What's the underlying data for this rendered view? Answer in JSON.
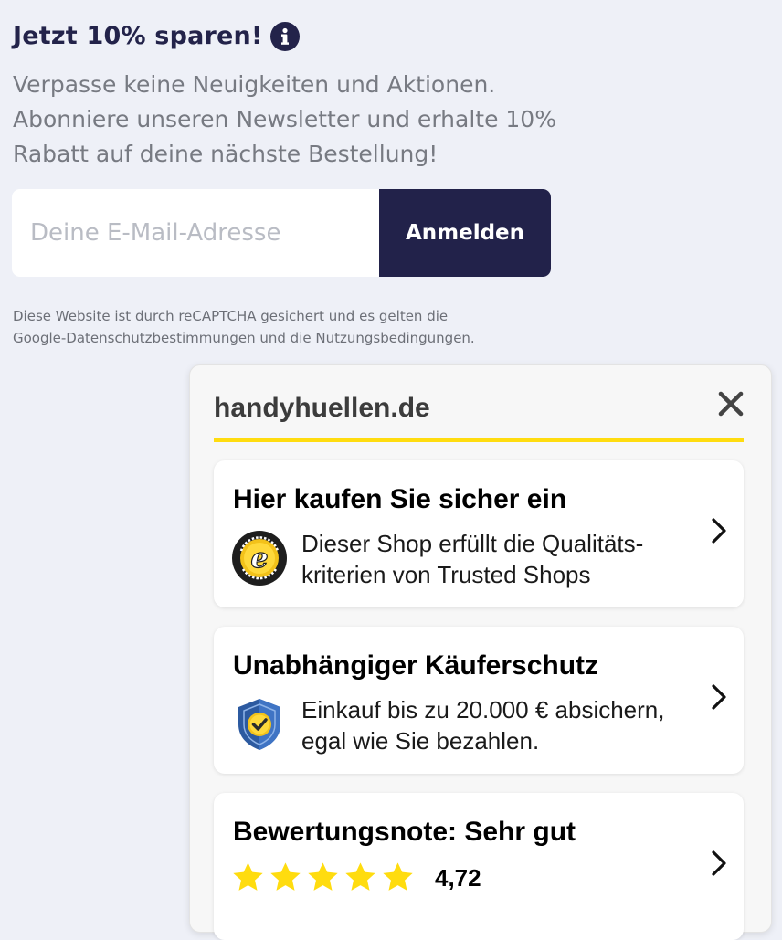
{
  "newsletter": {
    "title": "Jetzt 10% sparen!",
    "text_lines": [
      "Verpasse keine Neuigkeiten und Aktionen.",
      "Abonniere unseren Newsletter und erhalte 10%",
      "Rabatt auf deine nächste Bestellung!"
    ],
    "email_placeholder": "Deine E-Mail-Adresse",
    "email_value": "",
    "submit_label": "Anmelden",
    "recaptcha_lines": [
      "Diese Website ist durch reCAPTCHA gesichert und es gelten die",
      "Google-Datenschutzbestimmungen und die Nutzungsbedingungen."
    ]
  },
  "trusted_shops": {
    "shop_name": "handyhuellen.de",
    "cards": [
      {
        "title": "Hier kaufen Sie sicher ein",
        "desc_lines": [
          "Dieser Shop erfüllt die Qualitäts-",
          "kriterien von Trusted Shops"
        ],
        "icon": "trusted-shops-seal-icon"
      },
      {
        "title": "Unabhängiger Käuferschutz",
        "desc_lines": [
          "Einkauf bis zu 20.000 € absichern,",
          "egal wie Sie bezahlen."
        ],
        "icon": "shield-check-icon"
      },
      {
        "title": "Bewertungsnote: Sehr gut",
        "rating": "4,72",
        "stars": 5,
        "icon": "star-icon"
      }
    ]
  },
  "colors": {
    "background": "#eef0f7",
    "navy": "#22224a",
    "accent_yellow": "#ffdc0f",
    "star_yellow": "#ffdc0f"
  }
}
